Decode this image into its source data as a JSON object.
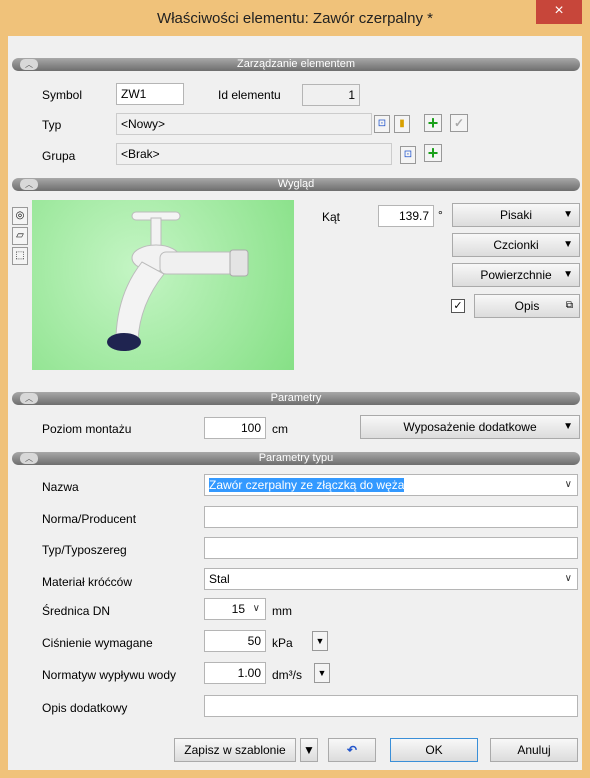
{
  "window": {
    "title": "Właściwości elementu: Zawór czerpalny *",
    "close": "×"
  },
  "sections": {
    "management": "Zarządzanie elementem",
    "appearance": "Wygląd",
    "params": "Parametry",
    "type_params": "Parametry typu"
  },
  "management": {
    "symbol_label": "Symbol",
    "symbol_value": "ZW1",
    "id_label": "Id elementu",
    "id_value": "1",
    "typ_label": "Typ",
    "typ_value": "<Nowy>",
    "grupa_label": "Grupa",
    "grupa_value": "<Brak>"
  },
  "appearance": {
    "kat_label": "Kąt",
    "kat_value": "139.7",
    "kat_unit": "°",
    "pisaki": "Pisaki",
    "czcionki": "Czcionki",
    "powierzchnie": "Powierzchnie",
    "opis": "Opis",
    "opis_checked": true
  },
  "params": {
    "poziom_label": "Poziom montażu",
    "poziom_value": "100",
    "poziom_unit": "cm",
    "wyposazenie": "Wyposażenie dodatkowe"
  },
  "type": {
    "nazwa_label": "Nazwa",
    "nazwa_value": "Zawór czerpalny ze złączką do węża",
    "norma_label": "Norma/Producent",
    "norma_value": "",
    "typoszereg_label": "Typ/Typoszereg",
    "typoszereg_value": "",
    "material_label": "Materiał króćców",
    "material_value": "Stal",
    "dn_label": "Średnica DN",
    "dn_value": "15",
    "dn_unit": "mm",
    "cisnienie_label": "Ciśnienie wymagane",
    "cisnienie_value": "50",
    "cisnienie_unit": "kPa",
    "normatyw_label": "Normatyw wypływu wody",
    "normatyw_value": "1.00",
    "normatyw_unit": "dm³/s",
    "opis_label": "Opis dodatkowy",
    "opis_value": ""
  },
  "footer": {
    "zapisz": "Zapisz w szablonie",
    "ok": "OK",
    "anuluj": "Anuluj"
  }
}
